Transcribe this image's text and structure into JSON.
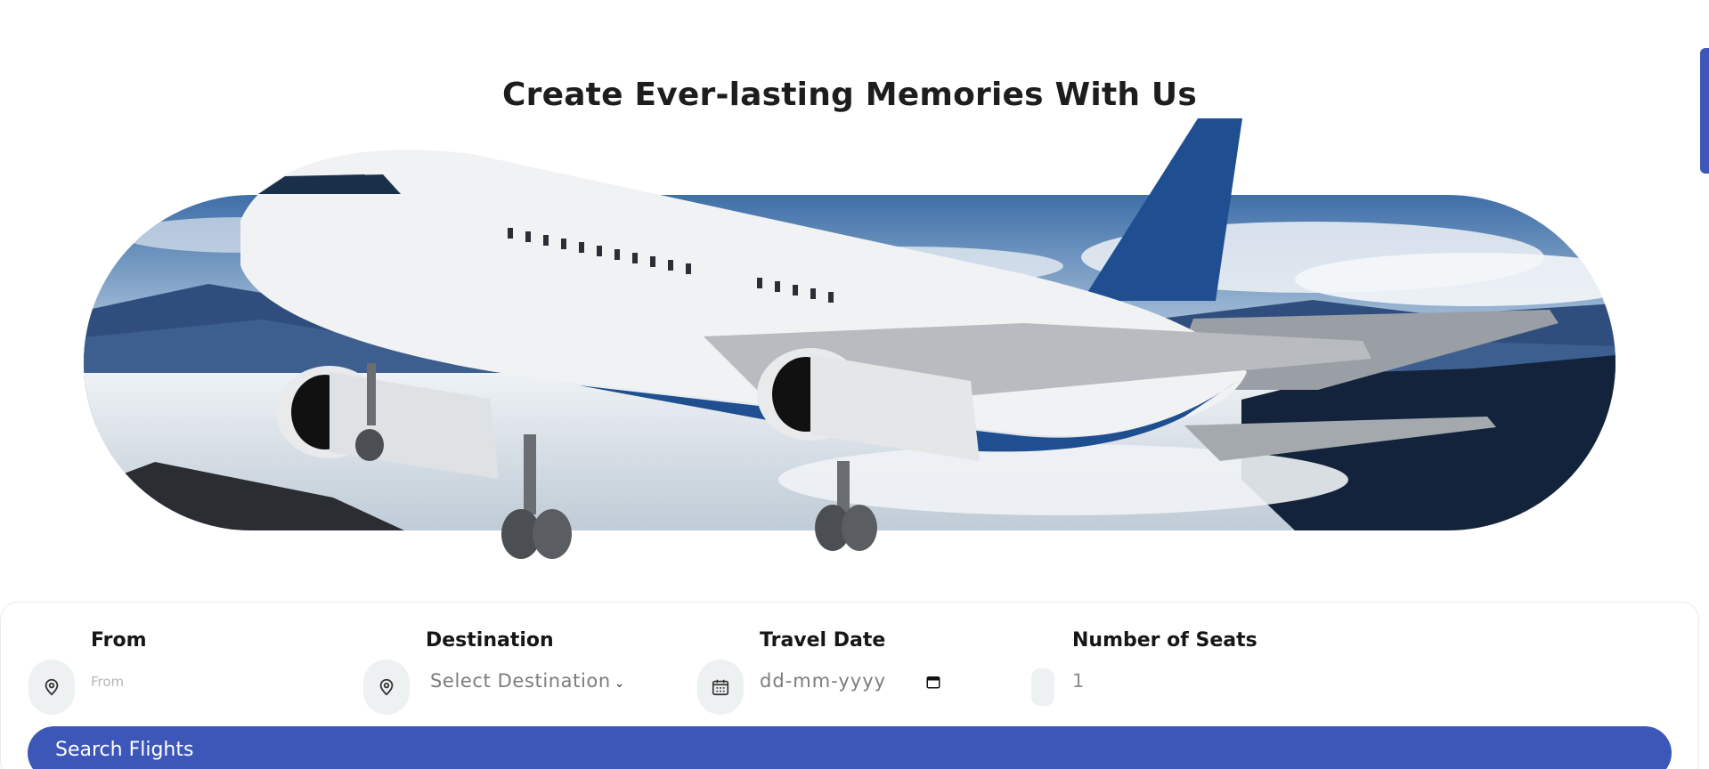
{
  "hero": {
    "title": "Create Ever-lasting Memories With Us"
  },
  "search_form": {
    "from": {
      "label": "From",
      "placeholder": "From",
      "icon": "location-pin-icon"
    },
    "destination": {
      "label": "Destination",
      "selected": "Select Destination",
      "icon": "location-pin-icon"
    },
    "travel_date": {
      "label": "Travel Date",
      "placeholder": "dd-mm-yyyy",
      "icon": "calendar-icon"
    },
    "seats": {
      "label": "Number of Seats",
      "value": "1"
    },
    "submit_label": "Search Flights"
  },
  "colors": {
    "accent": "#3c57b8",
    "icon_bg": "#edf1f1"
  }
}
